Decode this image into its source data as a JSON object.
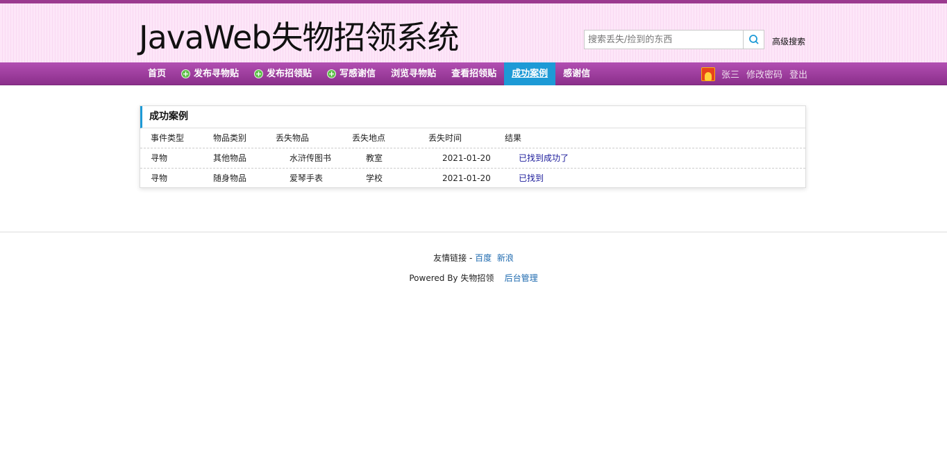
{
  "header": {
    "logo": "JavaWeb失物招领系统",
    "search_placeholder": "搜索丢失/捡到的东西",
    "advanced_search": "高级搜索"
  },
  "nav": {
    "items": [
      {
        "label": "首页",
        "plus": false,
        "active": false
      },
      {
        "label": "发布寻物贴",
        "plus": true,
        "active": false
      },
      {
        "label": "发布招领贴",
        "plus": true,
        "active": false
      },
      {
        "label": "写感谢信",
        "plus": true,
        "active": false
      },
      {
        "label": "浏览寻物贴",
        "plus": false,
        "active": false
      },
      {
        "label": "查看招领贴",
        "plus": false,
        "active": false
      },
      {
        "label": "成功案例",
        "plus": false,
        "active": true
      },
      {
        "label": "感谢信",
        "plus": false,
        "active": false
      }
    ],
    "user": "张三",
    "change_password": "修改密码",
    "logout": "登出"
  },
  "panel": {
    "title": "成功案例",
    "columns": [
      "事件类型",
      "物品类别",
      "丢失物品",
      "丢失地点",
      "丢失时间",
      "结果"
    ],
    "rows": [
      [
        "寻物",
        "其他物品",
        "水浒传图书",
        "教室",
        "2021-01-20",
        "已找到成功了"
      ],
      [
        "寻物",
        "随身物品",
        "爱琴手表",
        "学校",
        "2021-01-20",
        "已找到"
      ]
    ]
  },
  "footer": {
    "links_label": "友情链接 -",
    "link1": "百度",
    "link2": "新浪",
    "powered": "Powered By 失物招领",
    "admin": "后台管理"
  }
}
